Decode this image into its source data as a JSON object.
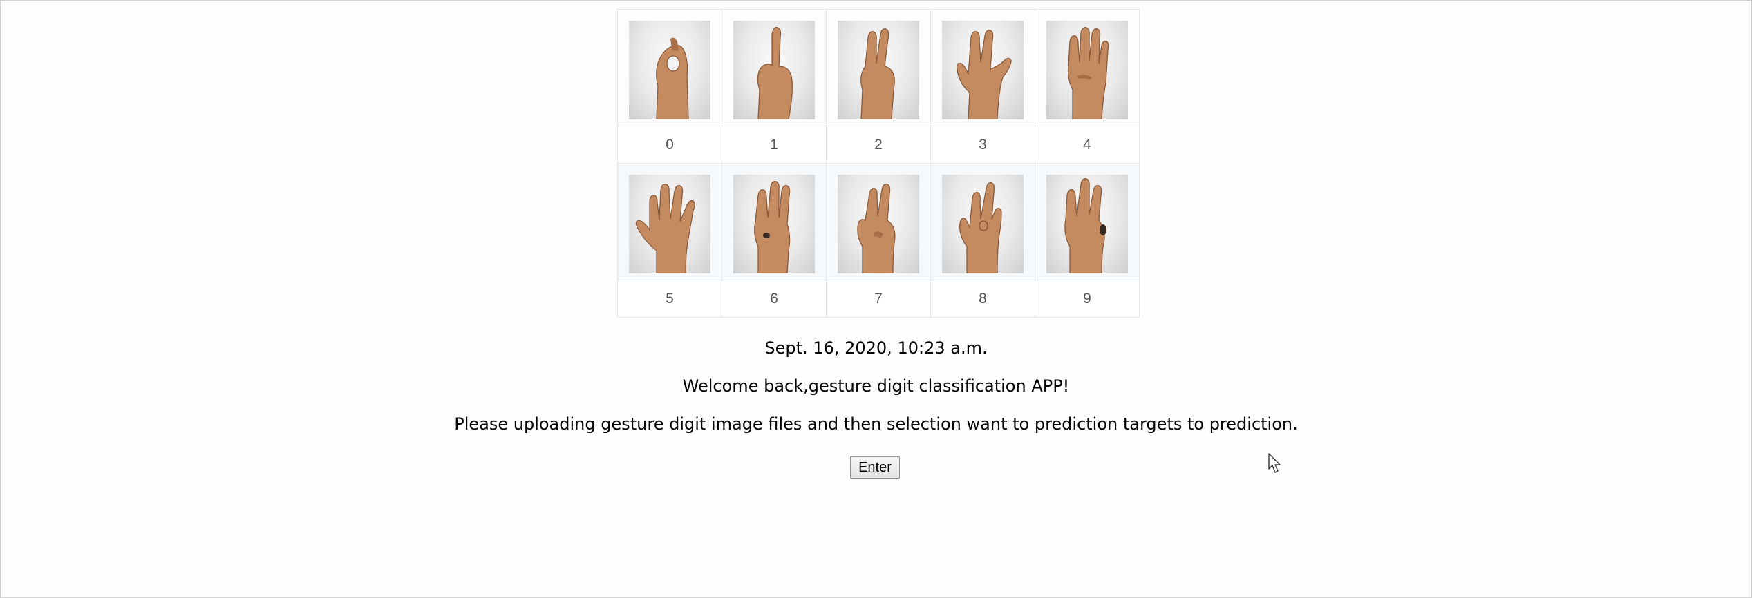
{
  "gestures": {
    "row1": [
      {
        "label": "0",
        "icon": "hand-gesture-zero-icon"
      },
      {
        "label": "1",
        "icon": "hand-gesture-one-icon"
      },
      {
        "label": "2",
        "icon": "hand-gesture-two-icon"
      },
      {
        "label": "3",
        "icon": "hand-gesture-three-icon"
      },
      {
        "label": "4",
        "icon": "hand-gesture-four-icon"
      }
    ],
    "row2": [
      {
        "label": "5",
        "icon": "hand-gesture-five-icon"
      },
      {
        "label": "6",
        "icon": "hand-gesture-six-icon"
      },
      {
        "label": "7",
        "icon": "hand-gesture-seven-icon"
      },
      {
        "label": "8",
        "icon": "hand-gesture-eight-icon"
      },
      {
        "label": "9",
        "icon": "hand-gesture-nine-icon"
      }
    ]
  },
  "page": {
    "date": "Sept. 16, 2020, 10:23 a.m.",
    "welcome": "Welcome back,gesture digit classification APP!",
    "instruction": "Please uploading gesture digit image files and then selection want to prediction targets to prediction.",
    "enter_label": "Enter"
  },
  "colors": {
    "skin": "#c48a60",
    "table_border": "#e3e6e9",
    "label_text": "#555555"
  }
}
